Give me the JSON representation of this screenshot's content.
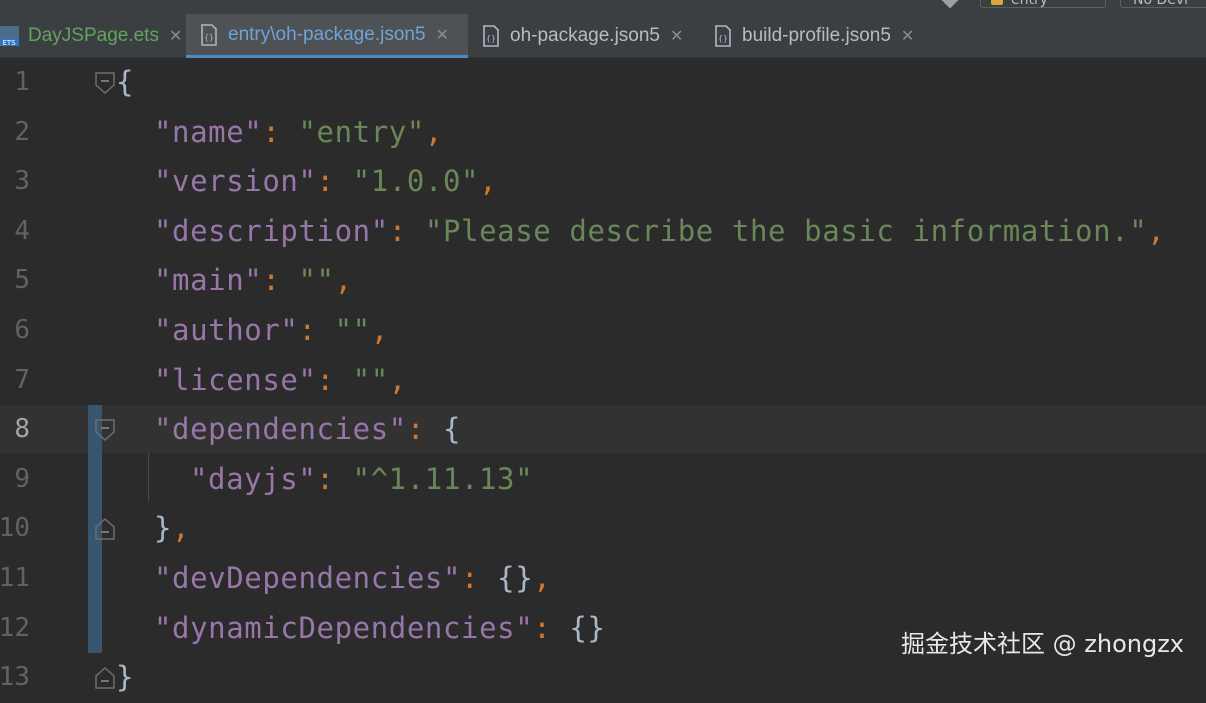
{
  "toolbar": {
    "run_config": "entry",
    "device": "No Devi"
  },
  "tabs": [
    {
      "label": "DayJSPage.ets",
      "icon": "ets-file-icon",
      "active": false
    },
    {
      "label": "entry\\oh-package.json5",
      "icon": "json5-file-icon",
      "active": true
    },
    {
      "label": "oh-package.json5",
      "icon": "json5-file-icon",
      "active": false
    },
    {
      "label": "build-profile.json5",
      "icon": "json5-file-icon",
      "active": false
    }
  ],
  "editor": {
    "current_line": 8,
    "lines": [
      {
        "n": "1"
      },
      {
        "n": "2",
        "key": "\"name\"",
        "colon": ": ",
        "value": "\"entry\"",
        "comma": ","
      },
      {
        "n": "3",
        "key": "\"version\"",
        "colon": ": ",
        "value": "\"1.0.0\"",
        "comma": ","
      },
      {
        "n": "4",
        "key": "\"description\"",
        "colon": ": ",
        "value": "\"Please describe the basic information.\"",
        "comma": ","
      },
      {
        "n": "5",
        "key": "\"main\"",
        "colon": ": ",
        "value": "\"\"",
        "comma": ","
      },
      {
        "n": "6",
        "key": "\"author\"",
        "colon": ": ",
        "value": "\"\"",
        "comma": ","
      },
      {
        "n": "7",
        "key": "\"license\"",
        "colon": ": ",
        "value": "\"\"",
        "comma": ","
      },
      {
        "n": "8",
        "key": "\"dependencies\"",
        "colon": ": ",
        "brace": "{"
      },
      {
        "n": "9",
        "key": "\"dayjs\"",
        "colon": ": ",
        "value": "\"^1.11.13\""
      },
      {
        "n": "10",
        "brace": "}",
        "comma": ","
      },
      {
        "n": "11",
        "key": "\"devDependencies\"",
        "colon": ": ",
        "brace": "{}",
        "comma": ","
      },
      {
        "n": "12",
        "key": "\"dynamicDependencies\"",
        "colon": ": ",
        "brace": "{}"
      },
      {
        "n": "13",
        "brace": "}"
      }
    ],
    "open_brace": "{"
  },
  "watermark": "掘金技术社区 @ zhongzx",
  "colors": {
    "background": "#2b2b2b",
    "key": "#9876aa",
    "string": "#6a8759",
    "punctuation": "#cc7832",
    "active_tab_underline": "#4a88c7"
  }
}
